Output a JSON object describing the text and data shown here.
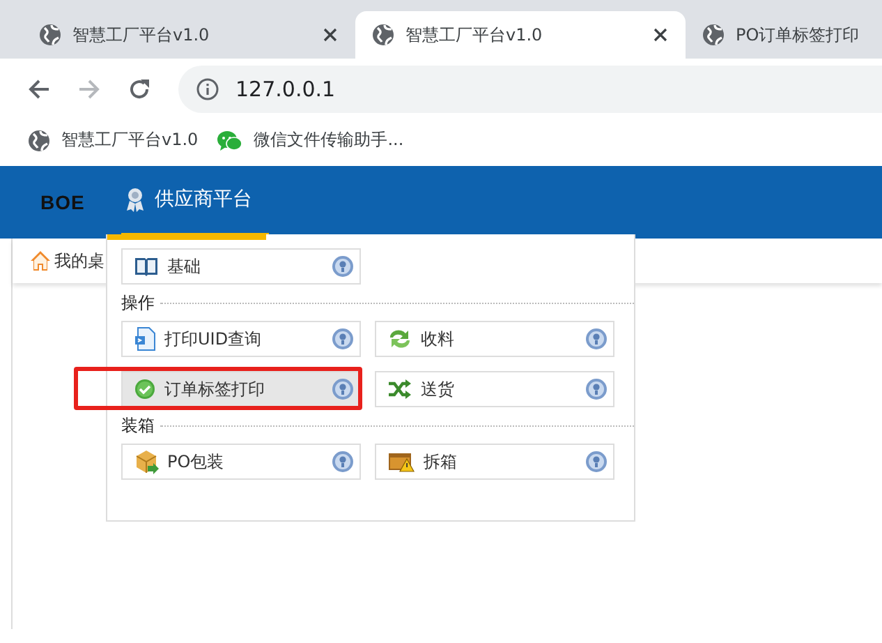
{
  "browser": {
    "tabs": [
      {
        "title": "智慧工厂平台v1.0",
        "selected": false,
        "closable": true
      },
      {
        "title": "智慧工厂平台v1.0",
        "selected": true,
        "closable": true
      },
      {
        "title": "PO订单标签打印",
        "selected": false,
        "closable": false
      }
    ],
    "address": "127.0.0.1",
    "bookmarks": [
      {
        "label": "智慧工厂平台v1.0",
        "kind": "globe"
      },
      {
        "label": "微信文件传输助手...",
        "kind": "chat"
      }
    ]
  },
  "header": {
    "logo": "BOE",
    "nav": [
      {
        "label": "供应商平台",
        "selected": true
      }
    ]
  },
  "page_tabs": [
    {
      "label": "我的桌"
    }
  ],
  "menu": {
    "sections": [
      {
        "items": [
          {
            "label": "基础",
            "kind": "book",
            "selected": false,
            "annotated": false
          }
        ]
      },
      {
        "title": "操作",
        "items": [
          {
            "label": "打印UID查询",
            "kind": "doc",
            "selected": false,
            "annotated": false
          },
          {
            "label": "收料",
            "kind": "refresh",
            "selected": false,
            "annotated": false
          },
          {
            "label": "订单标签打印",
            "kind": "check",
            "selected": true,
            "annotated": true
          },
          {
            "label": "送货",
            "kind": "shuffle",
            "selected": false,
            "annotated": false
          }
        ]
      },
      {
        "title": "装箱",
        "items": [
          {
            "label": "PO包装",
            "kind": "box",
            "selected": false,
            "annotated": false
          },
          {
            "label": "拆箱",
            "kind": "warnbox",
            "selected": false,
            "annotated": false
          }
        ]
      }
    ]
  }
}
